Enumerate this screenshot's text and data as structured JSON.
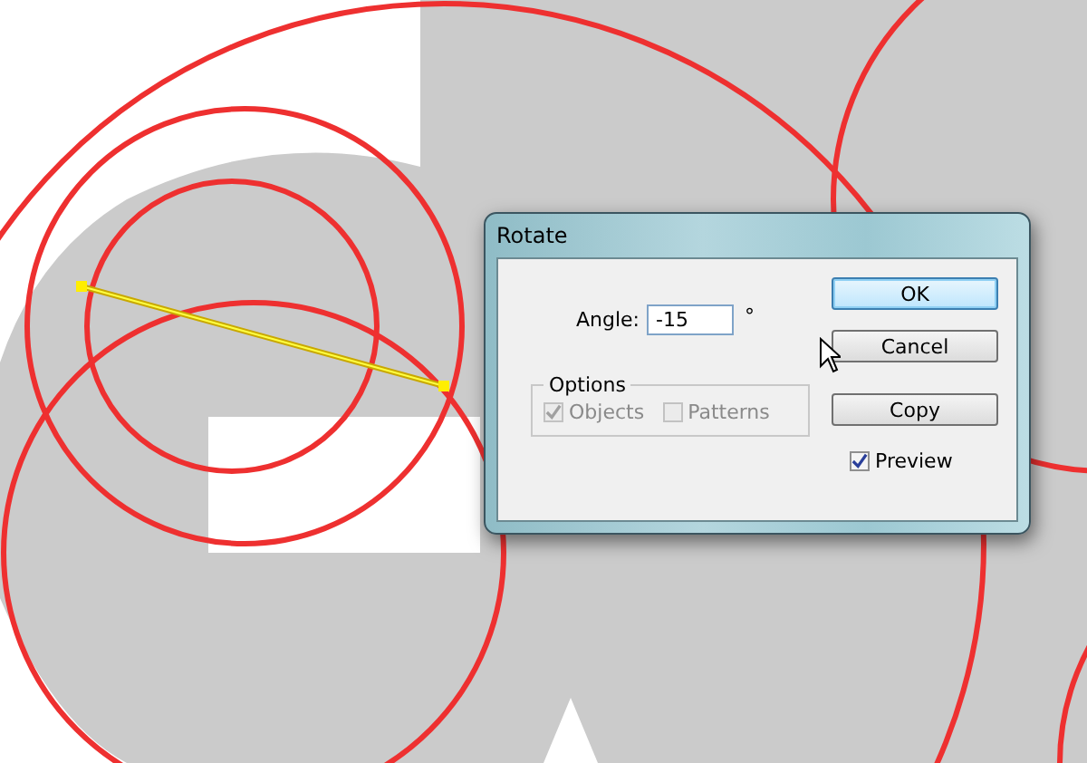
{
  "dialog": {
    "title": "Rotate",
    "angle": {
      "label": "Angle:",
      "value": "-15",
      "unit": "°"
    },
    "options": {
      "legend": "Options",
      "checkboxes": [
        {
          "label": "Objects",
          "checked": true,
          "disabled": true
        },
        {
          "label": "Patterns",
          "checked": false,
          "disabled": true
        }
      ]
    },
    "buttons": [
      {
        "label": "OK",
        "default": true
      },
      {
        "label": "Cancel",
        "default": false
      },
      {
        "label": "Copy",
        "default": false
      }
    ],
    "preview": {
      "label": "Preview",
      "checked": true
    }
  }
}
